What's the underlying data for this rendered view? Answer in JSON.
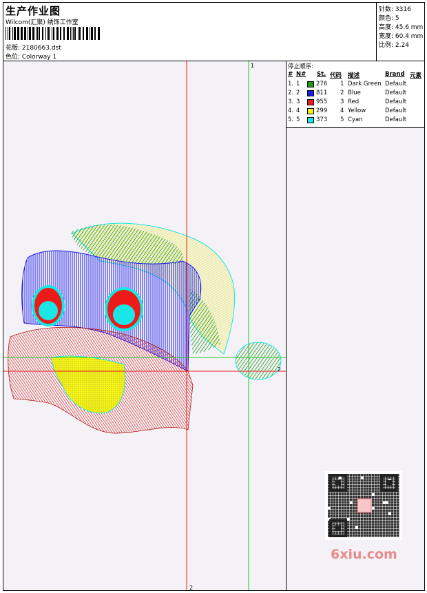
{
  "header": {
    "title": "生产作业图",
    "company": "Wilcom(汇聚) 绣饰工作室",
    "design": "花版: 2180663.dst",
    "colorway": "色位: Colorway 1"
  },
  "stats": {
    "stitches": "针数: 3316",
    "colors": "颜色: 5",
    "height": "高度: 45.6 mm",
    "width": "宽度: 60.4 mm",
    "scale": "比例: 2.24"
  },
  "sequence": {
    "title": "停止顺序:",
    "headers": [
      "#",
      "N#",
      "St.",
      "代码",
      "描述",
      "Brand",
      "元素"
    ],
    "rows": [
      {
        "idx": "1.",
        "n": "1",
        "st": "276",
        "code": "1",
        "desc": "Dark Green",
        "brand": "Default",
        "color": "#1a9a1a"
      },
      {
        "idx": "2.",
        "n": "2",
        "st": "811",
        "code": "2",
        "desc": "Blue",
        "brand": "Default",
        "color": "#1a1aee"
      },
      {
        "idx": "3.",
        "n": "3",
        "st": "955",
        "code": "3",
        "desc": "Red",
        "brand": "Default",
        "color": "#ee1a1a"
      },
      {
        "idx": "4.",
        "n": "4",
        "st": "299",
        "code": "4",
        "desc": "Yellow",
        "brand": "Default",
        "color": "#f2f21a"
      },
      {
        "idx": "5.",
        "n": "5",
        "st": "373",
        "code": "5",
        "desc": "Cyan",
        "brand": "Default",
        "color": "#1ae6e6"
      }
    ]
  },
  "axes": {
    "v1": "1",
    "v2": "2",
    "h2": "2"
  },
  "watermark": "6xiu.com"
}
